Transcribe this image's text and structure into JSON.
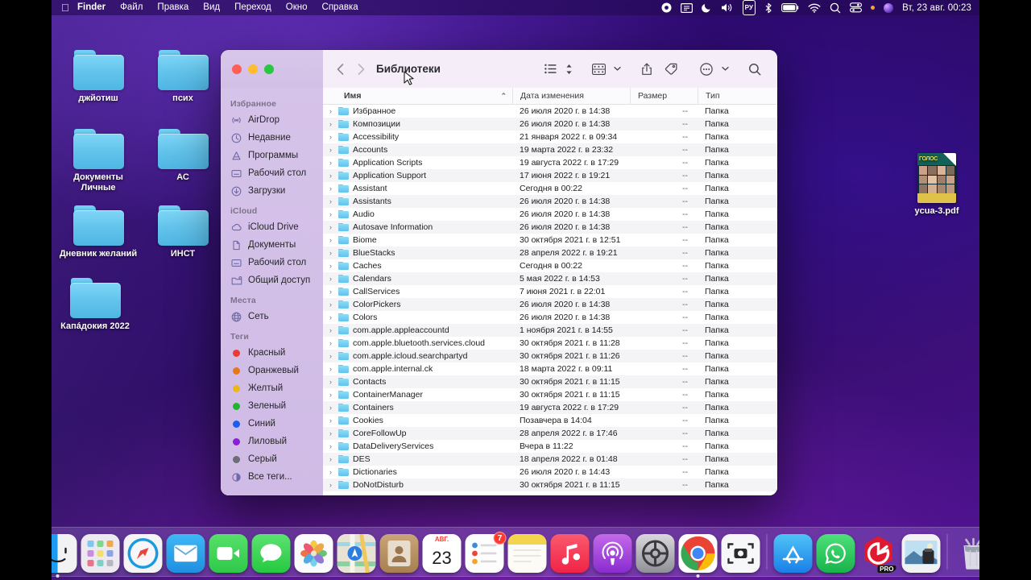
{
  "menubar": {
    "apple_glyph": "",
    "items": [
      {
        "label": "Finder",
        "bold": true
      },
      {
        "label": "Файл",
        "bold": false
      },
      {
        "label": "Правка",
        "bold": false
      },
      {
        "label": "Вид",
        "bold": false
      },
      {
        "label": "Переход",
        "bold": false
      },
      {
        "label": "Окно",
        "bold": false
      },
      {
        "label": "Справка",
        "bold": false
      }
    ],
    "status": {
      "input_source": "РУ",
      "clock": "Вт, 23 авг.  00:23"
    }
  },
  "desktop": {
    "icons": [
      {
        "name": "джйотиш",
        "type": "folder"
      },
      {
        "name": "псих",
        "type": "folder"
      },
      {
        "name": "Документы Личные",
        "type": "folder"
      },
      {
        "name": "АС",
        "type": "folder"
      },
      {
        "name": "Дневник желаний",
        "type": "folder"
      },
      {
        "name": "ИНСТ",
        "type": "folder"
      },
      {
        "name": "Капáдокия 2022",
        "type": "folder"
      },
      {
        "name": "ycua-3.pdf",
        "type": "pdf"
      }
    ]
  },
  "finder": {
    "title": "Библиотеки",
    "sidebar": [
      {
        "header": "Избранное",
        "items": [
          {
            "label": "AirDrop",
            "icon": "airdrop-icon"
          },
          {
            "label": "Недавние",
            "icon": "clock-icon"
          },
          {
            "label": "Программы",
            "icon": "applications-icon"
          },
          {
            "label": "Рабочий стол",
            "icon": "desktop-icon"
          },
          {
            "label": "Загрузки",
            "icon": "downloads-icon"
          }
        ]
      },
      {
        "header": "iCloud",
        "items": [
          {
            "label": "iCloud Drive",
            "icon": "cloud-icon"
          },
          {
            "label": "Документы",
            "icon": "document-icon"
          },
          {
            "label": "Рабочий стол",
            "icon": "desktop-icon"
          },
          {
            "label": "Общий доступ",
            "icon": "shared-folder-icon"
          }
        ]
      },
      {
        "header": "Места",
        "items": [
          {
            "label": "Сеть",
            "icon": "network-icon"
          }
        ]
      },
      {
        "header": "Теги",
        "items": [
          {
            "label": "Красный",
            "icon": "tag-dot",
            "color": "#ec3b36"
          },
          {
            "label": "Оранжевый",
            "icon": "tag-dot",
            "color": "#e8761b"
          },
          {
            "label": "Желтый",
            "icon": "tag-dot",
            "color": "#eab81c"
          },
          {
            "label": "Зеленый",
            "icon": "tag-dot",
            "color": "#22b32e"
          },
          {
            "label": "Синий",
            "icon": "tag-dot",
            "color": "#1a5ef0"
          },
          {
            "label": "Лиловый",
            "icon": "tag-dot",
            "color": "#8a1fd6"
          },
          {
            "label": "Серый",
            "icon": "tag-dot",
            "color": "#6c6c76"
          },
          {
            "label": "Все теги...",
            "icon": "all-tags-icon",
            "color": ""
          }
        ]
      }
    ],
    "columns": {
      "name": "Имя",
      "date": "Дата изменения",
      "size": "Размер",
      "type": "Тип",
      "sort_caret": "⌃"
    },
    "files": [
      {
        "name": "Избранное",
        "date": "26 июля 2020 г. в 14:38",
        "size": "--",
        "type": "Папка"
      },
      {
        "name": "Композиции",
        "date": "26 июля 2020 г. в 14:38",
        "size": "--",
        "type": "Папка"
      },
      {
        "name": "Accessibility",
        "date": "21 января 2022 г. в 09:34",
        "size": "--",
        "type": "Папка"
      },
      {
        "name": "Accounts",
        "date": "19 марта 2022 г. в 23:32",
        "size": "--",
        "type": "Папка"
      },
      {
        "name": "Application Scripts",
        "date": "19 августа 2022 г. в 17:29",
        "size": "--",
        "type": "Папка"
      },
      {
        "name": "Application Support",
        "date": "17 июня 2022 г. в 19:21",
        "size": "--",
        "type": "Папка"
      },
      {
        "name": "Assistant",
        "date": "Сегодня в 00:22",
        "size": "--",
        "type": "Папка"
      },
      {
        "name": "Assistants",
        "date": "26 июля 2020 г. в 14:38",
        "size": "--",
        "type": "Папка"
      },
      {
        "name": "Audio",
        "date": "26 июля 2020 г. в 14:38",
        "size": "--",
        "type": "Папка"
      },
      {
        "name": "Autosave Information",
        "date": "26 июля 2020 г. в 14:38",
        "size": "--",
        "type": "Папка"
      },
      {
        "name": "Biome",
        "date": "30 октября 2021 г. в 12:51",
        "size": "--",
        "type": "Папка"
      },
      {
        "name": "BlueStacks",
        "date": "28 апреля 2022 г. в 19:21",
        "size": "--",
        "type": "Папка"
      },
      {
        "name": "Caches",
        "date": "Сегодня в 00:22",
        "size": "--",
        "type": "Папка"
      },
      {
        "name": "Calendars",
        "date": "5 мая 2022 г. в 14:53",
        "size": "--",
        "type": "Папка"
      },
      {
        "name": "CallServices",
        "date": "7 июня 2021 г. в 22:01",
        "size": "--",
        "type": "Папка"
      },
      {
        "name": "ColorPickers",
        "date": "26 июля 2020 г. в 14:38",
        "size": "--",
        "type": "Папка"
      },
      {
        "name": "Colors",
        "date": "26 июля 2020 г. в 14:38",
        "size": "--",
        "type": "Папка"
      },
      {
        "name": "com.apple.appleaccountd",
        "date": "1 ноября 2021 г. в 14:55",
        "size": "--",
        "type": "Папка"
      },
      {
        "name": "com.apple.bluetooth.services.cloud",
        "date": "30 октября 2021 г. в 11:28",
        "size": "--",
        "type": "Папка"
      },
      {
        "name": "com.apple.icloud.searchpartyd",
        "date": "30 октября 2021 г. в 11:26",
        "size": "--",
        "type": "Папка"
      },
      {
        "name": "com.apple.internal.ck",
        "date": "18 марта 2022 г. в 09:11",
        "size": "--",
        "type": "Папка"
      },
      {
        "name": "Contacts",
        "date": "30 октября 2021 г. в 11:15",
        "size": "--",
        "type": "Папка"
      },
      {
        "name": "ContainerManager",
        "date": "30 октября 2021 г. в 11:15",
        "size": "--",
        "type": "Папка"
      },
      {
        "name": "Containers",
        "date": "19 августа 2022 г. в 17:29",
        "size": "--",
        "type": "Папка"
      },
      {
        "name": "Cookies",
        "date": "Позавчера в 14:04",
        "size": "--",
        "type": "Папка"
      },
      {
        "name": "CoreFollowUp",
        "date": "28 апреля 2022 г. в 17:46",
        "size": "--",
        "type": "Папка"
      },
      {
        "name": "DataDeliveryServices",
        "date": "Вчера в 11:22",
        "size": "--",
        "type": "Папка"
      },
      {
        "name": "DES",
        "date": "18 апреля 2022 г. в 01:48",
        "size": "--",
        "type": "Папка"
      },
      {
        "name": "Dictionaries",
        "date": "26 июля 2020 г. в 14:43",
        "size": "--",
        "type": "Папка"
      },
      {
        "name": "DoNotDisturb",
        "date": "30 октября 2021 г. в 11:15",
        "size": "--",
        "type": "Папка"
      }
    ]
  },
  "dock": {
    "calendar_month": "Авг.",
    "calendar_day": "23",
    "reminders_badge": "7",
    "cleanmymac_label": "PRO",
    "items": [
      {
        "name": "finder",
        "running": true
      },
      {
        "name": "launchpad",
        "running": false
      },
      {
        "name": "safari",
        "running": false
      },
      {
        "name": "mail",
        "running": false
      },
      {
        "name": "facetime",
        "running": false
      },
      {
        "name": "messages",
        "running": false
      },
      {
        "name": "photos",
        "running": false
      },
      {
        "name": "maps",
        "running": false
      },
      {
        "name": "contacts",
        "running": false
      },
      {
        "name": "calendar",
        "running": false
      },
      {
        "name": "reminders",
        "running": false
      },
      {
        "name": "notes",
        "running": false
      },
      {
        "name": "music",
        "running": false
      },
      {
        "name": "podcasts",
        "running": false
      },
      {
        "name": "system-settings",
        "running": false
      },
      {
        "name": "chrome",
        "running": true
      },
      {
        "name": "screenshot",
        "running": false
      },
      {
        "name": "app-store",
        "running": false
      },
      {
        "name": "whatsapp",
        "running": false
      },
      {
        "name": "cleanmymac",
        "running": false
      },
      {
        "name": "preview",
        "running": false
      },
      {
        "name": "trash",
        "running": false
      }
    ]
  }
}
